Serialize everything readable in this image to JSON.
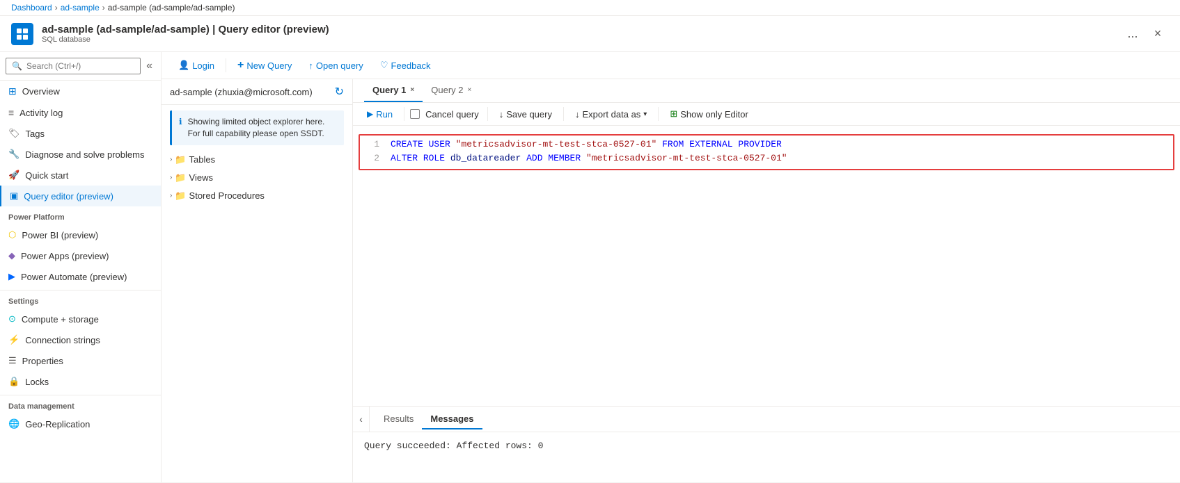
{
  "header": {
    "app_icon_label": "Azure",
    "title": "ad-sample (ad-sample/ad-sample) | Query editor (preview)",
    "subtitle": "SQL database",
    "ellipsis_label": "...",
    "close_label": "×"
  },
  "breadcrumb": {
    "items": [
      "Dashboard",
      "ad-sample",
      "ad-sample (ad-sample/ad-sample)"
    ]
  },
  "sidebar": {
    "search_placeholder": "Search (Ctrl+/)",
    "collapse_icon": "«",
    "nav_items": [
      {
        "id": "overview",
        "label": "Overview",
        "icon": "home"
      },
      {
        "id": "activity-log",
        "label": "Activity log",
        "icon": "list"
      },
      {
        "id": "tags",
        "label": "Tags",
        "icon": "tag"
      },
      {
        "id": "diagnose",
        "label": "Diagnose and solve problems",
        "icon": "wrench"
      },
      {
        "id": "quick-start",
        "label": "Quick start",
        "icon": "rocket"
      },
      {
        "id": "query-editor",
        "label": "Query editor (preview)",
        "icon": "db",
        "active": true
      }
    ],
    "sections": [
      {
        "label": "Power Platform",
        "items": [
          {
            "id": "power-bi",
            "label": "Power BI (preview)",
            "icon": "power-bi"
          },
          {
            "id": "power-apps",
            "label": "Power Apps (preview)",
            "icon": "power-apps"
          },
          {
            "id": "power-automate",
            "label": "Power Automate (preview)",
            "icon": "power-automate"
          }
        ]
      },
      {
        "label": "Settings",
        "items": [
          {
            "id": "compute-storage",
            "label": "Compute + storage",
            "icon": "compute"
          },
          {
            "id": "connection-strings",
            "label": "Connection strings",
            "icon": "connection"
          },
          {
            "id": "properties",
            "label": "Properties",
            "icon": "properties"
          },
          {
            "id": "locks",
            "label": "Locks",
            "icon": "lock"
          }
        ]
      },
      {
        "label": "Data management",
        "items": [
          {
            "id": "geo-replication",
            "label": "Geo-Replication",
            "icon": "geo"
          }
        ]
      }
    ]
  },
  "toolbar": {
    "login_label": "Login",
    "new_query_label": "New Query",
    "open_query_label": "Open query",
    "feedback_label": "Feedback"
  },
  "object_explorer": {
    "connection_label": "ad-sample (zhuxia@microsoft.com)",
    "refresh_icon": "↻",
    "info_message": "Showing limited object explorer here. For full capability please open SSDT.",
    "tree_items": [
      {
        "label": "Tables",
        "expandable": true
      },
      {
        "label": "Views",
        "expandable": true
      },
      {
        "label": "Stored Procedures",
        "expandable": true
      }
    ]
  },
  "query_editor": {
    "tabs": [
      {
        "id": "query1",
        "label": "Query 1",
        "active": true,
        "closeable": true
      },
      {
        "id": "query2",
        "label": "Query 2",
        "active": false,
        "closeable": true
      }
    ],
    "toolbar": {
      "run_label": "Run",
      "cancel_label": "Cancel query",
      "save_label": "Save query",
      "export_label": "Export data as",
      "show_editor_label": "Show only Editor"
    },
    "code_lines": [
      {
        "num": "1",
        "content": "CREATE USER \"metricsadvisor-mt-test-stca-0527-01\" FROM EXTERNAL PROVIDER"
      },
      {
        "num": "2",
        "content": "ALTER ROLE db_datareader ADD MEMBER \"metricsadvisor-mt-test-stca-0527-01\""
      }
    ]
  },
  "results_panel": {
    "tabs": [
      {
        "label": "Results",
        "active": false
      },
      {
        "label": "Messages",
        "active": true
      }
    ],
    "message": "Query succeeded: Affected rows: 0"
  },
  "icons": {
    "search": "🔍",
    "home": "⊞",
    "list": "☰",
    "tag": "🏷",
    "wrench": "🔧",
    "rocket": "🚀",
    "db": "▣",
    "run": "▶",
    "chevron_down": "▾",
    "expand": "›",
    "folder": "📁",
    "info": "ℹ",
    "login": "👤",
    "plus": "+",
    "upload": "↑",
    "heart": "♡",
    "grid": "⊞",
    "collapse": "‹"
  }
}
